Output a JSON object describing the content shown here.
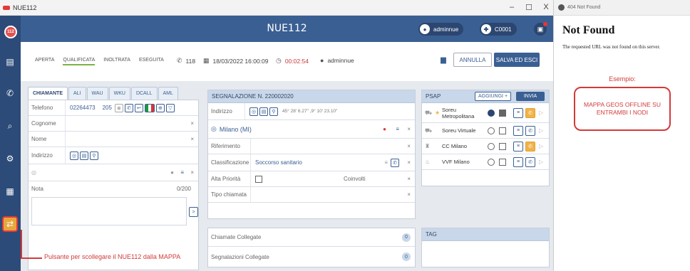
{
  "window": {
    "title": "NUE112",
    "minimize": "–",
    "maximize": "☐",
    "close": "X"
  },
  "rail": {
    "logo": "112"
  },
  "header": {
    "title": "NUE112",
    "user_label": "adminnue",
    "station_label": "C0001"
  },
  "toolbar": {
    "steps": [
      "APERTA",
      "QUALIFICATA",
      "INOLTRATA",
      "ESEGUITA"
    ],
    "active_step": "QUALIFICATA",
    "line": "118",
    "datetime": "18/03/2022 16:00:09",
    "timer": "00:02:54",
    "operator": "adminnue",
    "annulla": "ANNULLA",
    "salva": "SALVA ED ESCI"
  },
  "chiamante": {
    "tabs": [
      "CHIAMANTE",
      "ALI",
      "WAU",
      "WKU",
      "DCALL",
      "AML"
    ],
    "telefono_label": "Telefono",
    "telefono": "02264473",
    "telefono_ext": "205",
    "cognome_label": "Cognome",
    "nome_label": "Nome",
    "indirizzo_label": "Indirizzo",
    "nota_label": "Nota",
    "nota_count": "0/200"
  },
  "segnalazione": {
    "header": "SEGNALAZIONE N. 220002020",
    "indirizzo_label": "Indirizzo",
    "coords": "45° 28' 6.27\" ,9° 10' 23.10\"",
    "location": "Milano (MI)",
    "riferimento_label": "Riferimento",
    "classificazione_label": "Classificazione",
    "classificazione": "Soccorso sanitario",
    "alta_priorita_label": "Alta Priorità",
    "coinvolti_label": "Coinvolti",
    "tipo_chiamata_label": "Tipo chiamata"
  },
  "collegate": {
    "chiamate": "Chiamate Collegate",
    "chiamate_count": "0",
    "segnalazioni": "Segnalazioni Collegate",
    "segnalazioni_count": "0"
  },
  "psap": {
    "header": "PSAP",
    "aggiungi": "AGGIUNGI +",
    "invia": "INVIA",
    "rows": [
      {
        "name": "Soreu Metropolitana",
        "radio": true,
        "check": true
      },
      {
        "name": "Soreu Virtuale",
        "radio": false,
        "check": false
      },
      {
        "name": "CC Milano",
        "radio": false,
        "check": false
      },
      {
        "name": "VVF Milano",
        "radio": false,
        "check": false
      }
    ]
  },
  "tag": {
    "header": "TAG"
  },
  "annotations": {
    "callout_left": "Pulsante per scollegare il NUE112 dalla MAPPA",
    "esempio": "Esempio:",
    "box": "MAPPA GEOS OFFLINE SU ENTRAMBI I NODI"
  },
  "browser": {
    "tab_title": "404 Not Found",
    "heading": "Not Found",
    "message": "The requested URL was not found on this server."
  },
  "colors": {
    "primary": "#3a5f93",
    "rail": "#2c4b79",
    "alert": "#d23a3a",
    "accent": "#f0b34a"
  }
}
